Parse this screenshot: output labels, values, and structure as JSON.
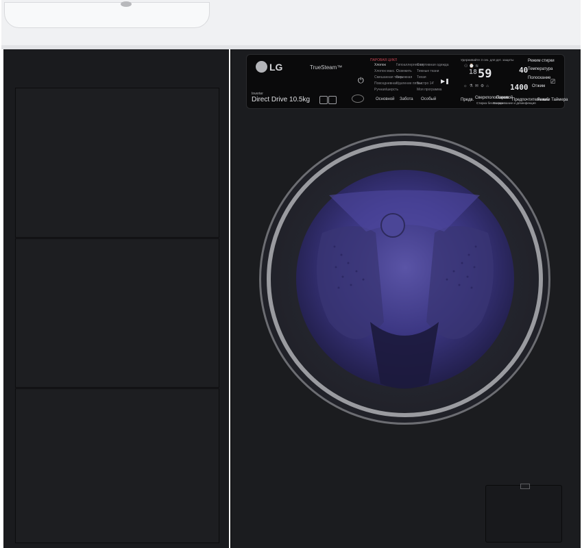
{
  "brand": {
    "logo_text": "LG",
    "feature_text": "TrueSteam™",
    "inverter_text": "Inverter",
    "model_text": "Direct Drive 10.5kg"
  },
  "program_cycles": {
    "header": "ПАРОВАЯ ЦИКЛ",
    "column1": [
      "Хлопок",
      "Хлопок макс. С",
      "Смешанная ткань",
      "Повседневная",
      "Ручная/шерсть"
    ],
    "column2": [
      "Гипоаллергенная",
      "Освежить",
      "Бережная",
      "Удаление пятен"
    ],
    "column3": [
      "Спортивная одежда",
      "Темные ткани",
      "Тихая",
      "Быстро 14'",
      "Моя программа"
    ]
  },
  "program_tabs": [
    "Основной",
    "Забота",
    "Особый"
  ],
  "display": {
    "digits_main": "59",
    "digits_small": "18",
    "temperature": "40",
    "spin": "1400"
  },
  "right_labels": [
    "Режим стирки",
    "Температура",
    "Полоскание",
    "Отжим"
  ],
  "bottom_buttons": [
    "Предв.",
    "Сверхполоскание",
    "Паровой",
    "Предпочтительный",
    "Режим Таймера"
  ],
  "bottom_button_subs": [
    "Стирка без стирки",
    "Выпаривание и дезинфекция"
  ],
  "display_note": "Удерживайте 3 сек. для дет. защиты"
}
